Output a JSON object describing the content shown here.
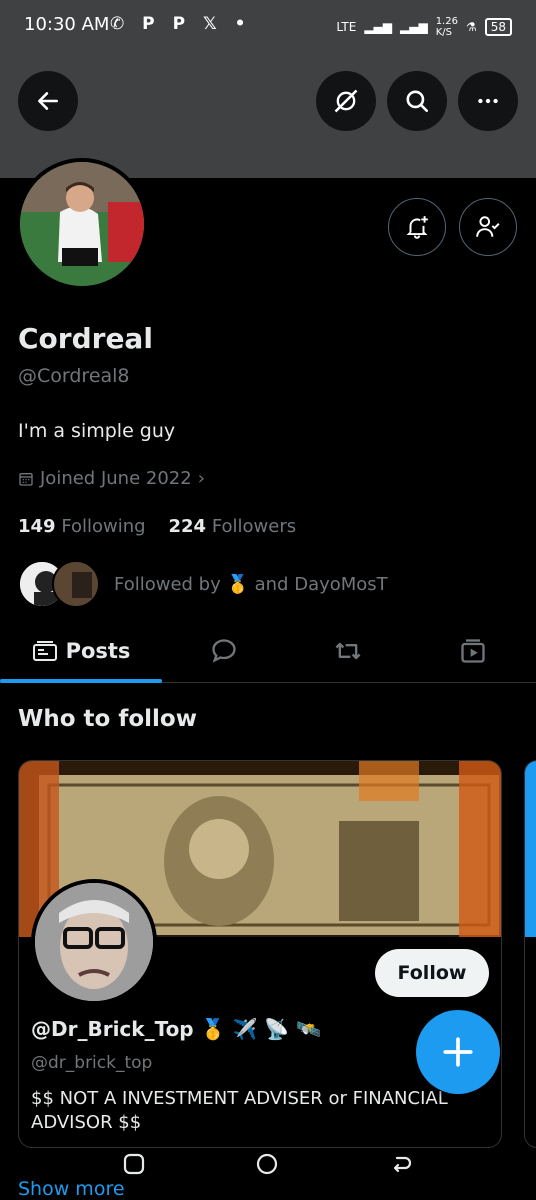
{
  "status_bar": {
    "time": "10:30 AM",
    "left_icons": [
      "whatsapp-icon",
      "p-icon",
      "p-icon",
      "x-icon",
      "dot-icon"
    ],
    "network": "LTE",
    "speed": "1.26",
    "speed_unit": "K/S",
    "battery": "58"
  },
  "header": {
    "back_icon": "back-arrow-icon",
    "grok_icon": "grok-icon",
    "search_icon": "search-icon",
    "more_icon": "more-icon",
    "banner_color": "#3f4143"
  },
  "profile": {
    "name": "Cordreal",
    "handle": "@Cordreal8",
    "bio": "I'm a simple guy",
    "joined": "Joined June 2022",
    "following_count": "149",
    "following_label": "Following",
    "followers_count": "224",
    "followers_label": "Followers",
    "followed_by": "Followed by 🥇 and DayoMosT"
  },
  "tabs": [
    {
      "label": "Posts",
      "icon": "posts-icon",
      "active": true
    },
    {
      "label": "",
      "icon": "replies-icon",
      "active": false
    },
    {
      "label": "",
      "icon": "retweet-icon",
      "active": false
    },
    {
      "label": "",
      "icon": "media-icon",
      "active": false
    }
  ],
  "who_to_follow": {
    "title": "Who to follow",
    "card": {
      "name": "@Dr_Brick_Top 🥇 ✈️ 📡 🛰️",
      "handle": "@dr_brick_top",
      "bio": "$$ NOT A INVESTMENT ADVISER or FINANCIAL ADVISOR $$",
      "follow_label": "Follow"
    },
    "show_more": "Show more"
  },
  "colors": {
    "accent": "#1d9bf0",
    "background": "#000000",
    "muted": "#71767b"
  }
}
